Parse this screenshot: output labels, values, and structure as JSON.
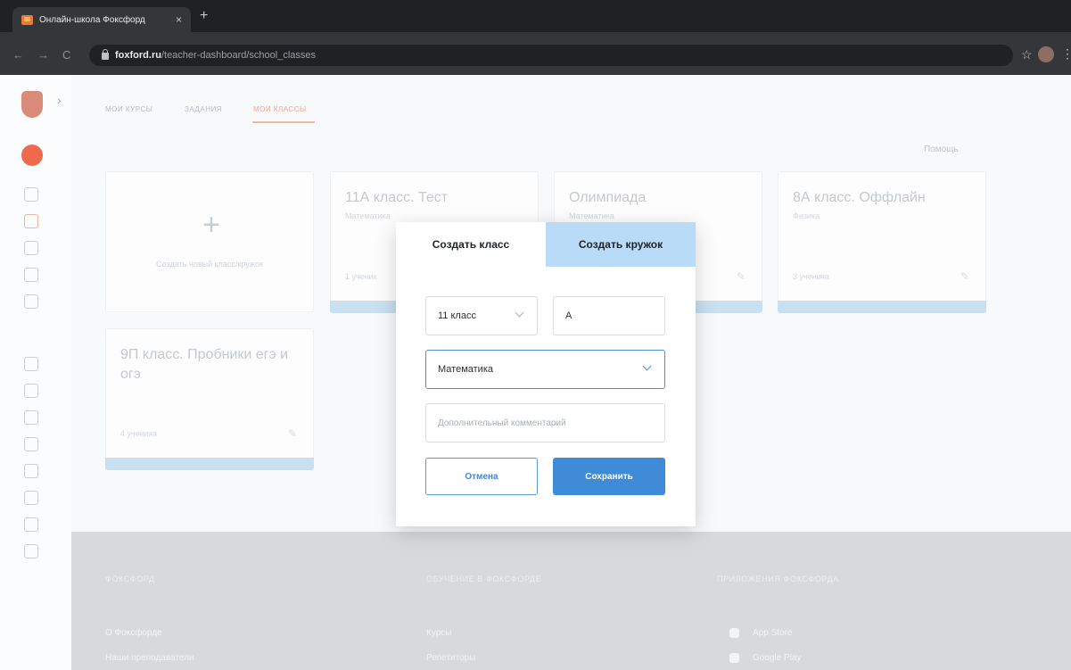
{
  "browser": {
    "tab_title": "Онлайн-школа Фоксфорд",
    "tab_close": "×",
    "new_tab": "+",
    "url_host": "foxford.ru",
    "url_path": "/teacher-dashboard/school_classes",
    "back": "←",
    "forward": "→",
    "reload": "C",
    "star": "☆",
    "menu": "⋮"
  },
  "nav_tabs": [
    "МОИ КУРСЫ",
    "ЗАДАНИЯ",
    "МОИ КЛАССЫ"
  ],
  "help_link": "Помощь",
  "classes": [
    {
      "title": "11А класс. Тест",
      "subject": "Математика",
      "footer": "1 ученик"
    },
    {
      "title": "Олимпиада",
      "subject": "Математика",
      "footer": ""
    },
    {
      "title": "8А класс. Оффлайн",
      "subject": "Физика",
      "footer": "3 ученика"
    },
    {
      "title": "9П класс. Пробники егэ и огэ",
      "subject": "",
      "footer": "4 ученика"
    }
  ],
  "add_card": {
    "plus": "+",
    "label": "Создать новый класс/кружок"
  },
  "footer": {
    "col1_head": "ФОКСФОРД",
    "col2_head": "ОБУЧЕНИЕ В ФОКСФОРДЕ",
    "col3_head": "ПРИЛОЖЕНИЯ ФОКСФОРДА",
    "col1_links": [
      "О Фоксфорде",
      "Наши преподаватели"
    ],
    "col2_links": [
      "Курсы",
      "Репетиторы"
    ],
    "col3_links": [
      "App Store",
      "Google Play"
    ]
  },
  "modal": {
    "tab_class": "Создать класс",
    "tab_circle": "Создать кружок",
    "grade_value": "11 класс",
    "letter_value": "А",
    "subject_value": "Математика",
    "comment_placeholder": "Дополнительный комментарий",
    "cancel": "Отмена",
    "save": "Сохранить"
  },
  "colors": {
    "primary": "#3f8bd8",
    "tab_active_bg": "#b9dbf7",
    "accent_orange": "#ef6a4c"
  }
}
